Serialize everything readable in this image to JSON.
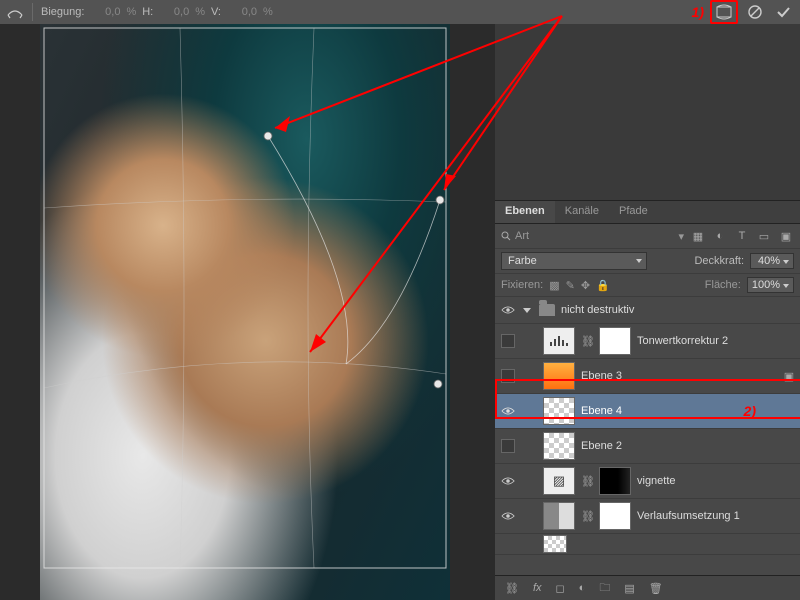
{
  "topbar": {
    "biegung_label": "Biegung:",
    "biegung_value": "0,0",
    "h_label": "H:",
    "h_value": "0,0",
    "v_label": "V:",
    "v_value": "0,0",
    "pct": "%",
    "anno1": "1)"
  },
  "panel": {
    "tabs": [
      "Ebenen",
      "Kanäle",
      "Pfade"
    ],
    "search_placeholder": "Art",
    "blend_mode": "Farbe",
    "opacity_label": "Deckkraft:",
    "opacity_value": "40%",
    "lock_label": "Fixieren:",
    "fill_label": "Fläche:",
    "fill_value": "100%"
  },
  "layers": {
    "group_name": "nicht destruktiv",
    "items": [
      {
        "name": "Tonwertkorrektur 2"
      },
      {
        "name": "Ebene 3"
      },
      {
        "name": "Ebene 4"
      },
      {
        "name": "Ebene 2"
      },
      {
        "name": "vignette"
      },
      {
        "name": "Verlaufsumsetzung 1"
      }
    ],
    "anno2": "2)"
  }
}
